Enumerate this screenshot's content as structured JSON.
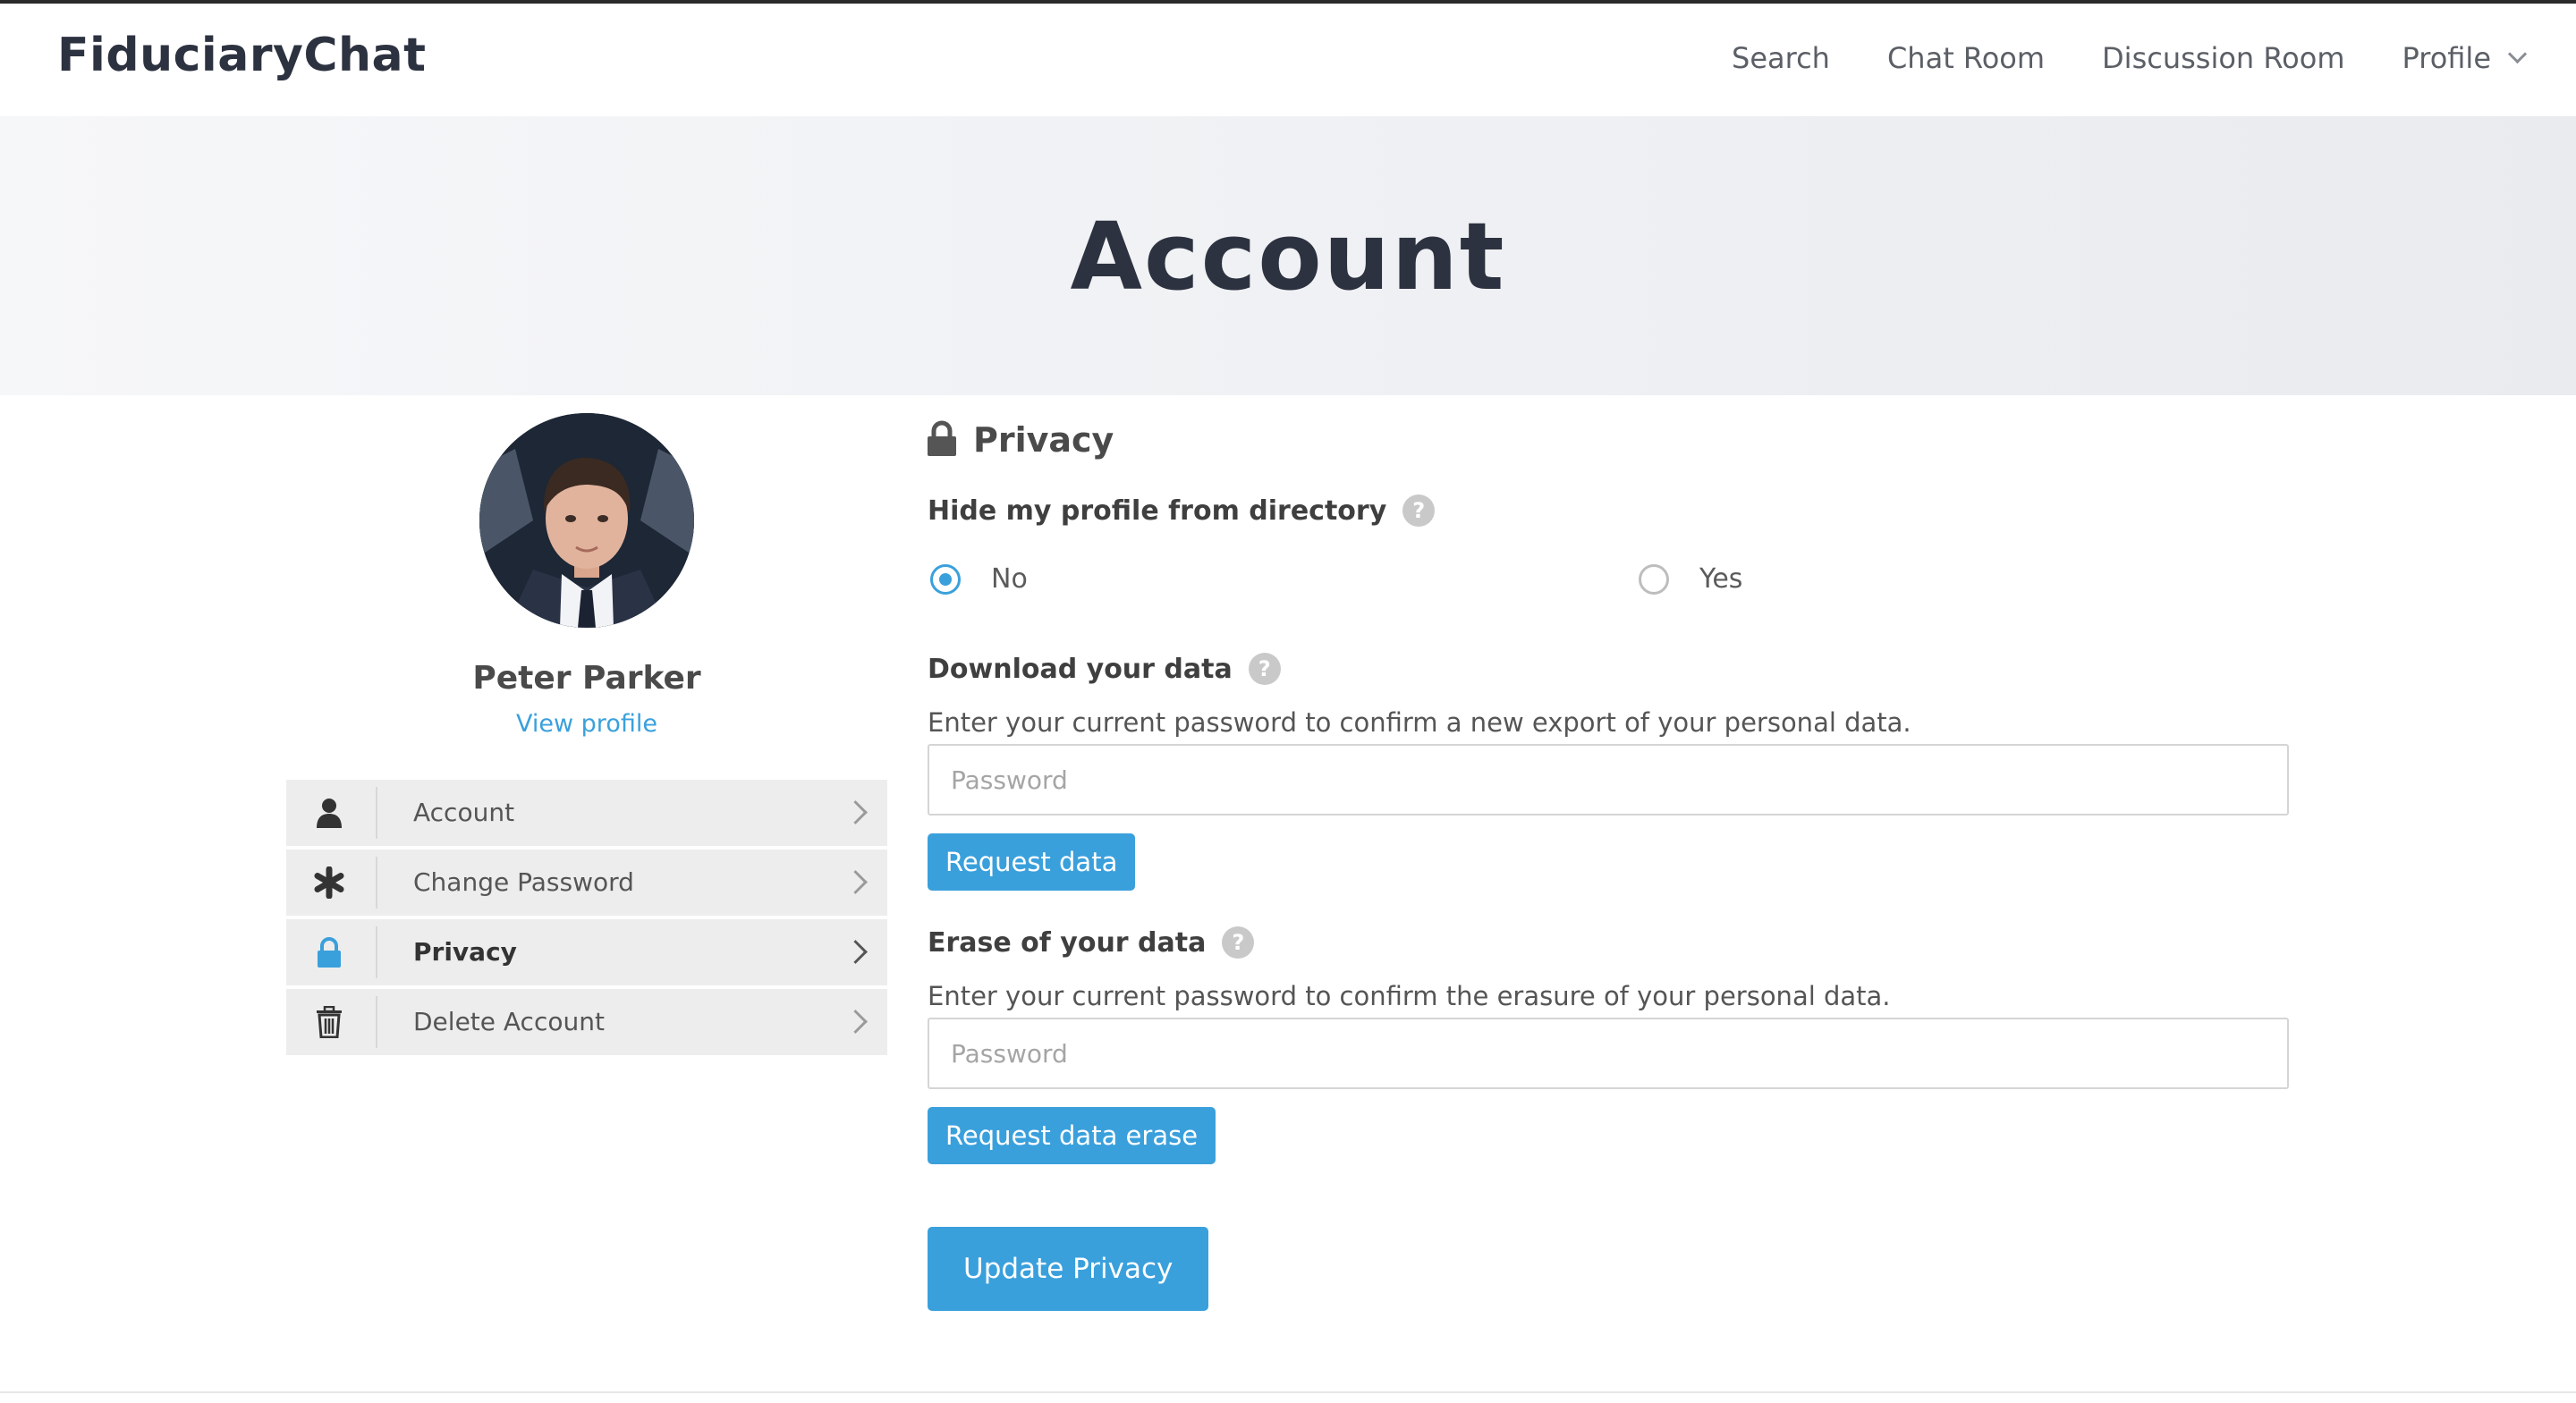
{
  "brand": "FiduciaryChat",
  "nav": {
    "links": [
      "Search",
      "Chat Room",
      "Discussion Room"
    ],
    "profile_label": "Profile"
  },
  "hero": {
    "title": "Account"
  },
  "user": {
    "name": "Peter Parker",
    "view_profile": "View profile"
  },
  "sidebar": {
    "items": [
      {
        "label": "Account",
        "icon": "user-icon",
        "active": false
      },
      {
        "label": "Change Password",
        "icon": "asterisk-icon",
        "active": false
      },
      {
        "label": "Privacy",
        "icon": "lock-icon",
        "active": true
      },
      {
        "label": "Delete Account",
        "icon": "trash-icon",
        "active": false
      }
    ]
  },
  "privacy": {
    "title": "Privacy",
    "hide_profile": {
      "label": "Hide my profile from directory",
      "options": [
        {
          "label": "No",
          "checked": true
        },
        {
          "label": "Yes",
          "checked": false
        }
      ]
    },
    "download": {
      "label": "Download your data",
      "description": "Enter your current password to confirm a new export of your personal data.",
      "placeholder": "Password",
      "button": "Request data"
    },
    "erase": {
      "label": "Erase of your data",
      "description": "Enter your current password to confirm the erasure of your personal data.",
      "placeholder": "Password",
      "button": "Request data erase"
    },
    "submit": "Update Privacy"
  },
  "colors": {
    "accent": "#3aa0dc",
    "brand_text": "#2d3240",
    "menu_bg": "#ededed"
  }
}
